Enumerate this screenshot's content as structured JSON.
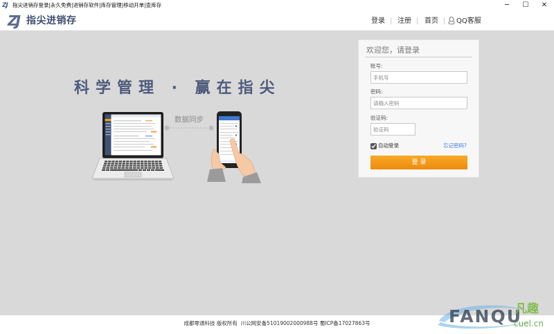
{
  "window": {
    "app_icon": "ZJ",
    "title": "指尖进销存登录|永久免费|进销存软件|库存管理|移动开单|查库存",
    "controls": {
      "minimize": {
        "icon": "minimize-icon",
        "glyph": "─"
      },
      "maximize": {
        "icon": "maximize-icon",
        "glyph": "☐"
      },
      "close": {
        "icon": "close-icon",
        "glyph": "✕"
      }
    }
  },
  "header": {
    "logo_mark": "ZJ",
    "logo_text": "指尖进销存",
    "separator": "|",
    "nav": [
      {
        "label": "登录"
      },
      {
        "label": "注册"
      },
      {
        "label": "首页"
      },
      {
        "label": "QQ客服",
        "icon": "qq-icon"
      }
    ]
  },
  "hero": {
    "slogan": "科学管理 · 赢在指尖",
    "sync_label": "数据同步"
  },
  "login": {
    "title": "欢迎您，请登录",
    "account_label": "账号:",
    "account_value": "",
    "account_placeholder": "手机号",
    "password_label": "密码:",
    "password_value": "",
    "password_placeholder": "请输入密码",
    "captcha_label": "验证码:",
    "captcha_value": "",
    "captcha_placeholder": "验证码",
    "auto_login_label": "自动登录",
    "auto_login_checked": true,
    "forgot_link": "忘记密码?",
    "submit_label": "登 录"
  },
  "footer": {
    "text": "成都零通科技 版权所有  川公网安备51019002000988号 蜀ICP备17027863号"
  },
  "watermark": {
    "brand": "FANQU",
    "brand_cn": "凡趣",
    "domain": "cuel.cn"
  },
  "colors": {
    "background": "#d9d9d9",
    "slogan": "#4d5b7c",
    "accent_orange": "#f0921a",
    "link_blue": "#3b7dd8",
    "panel": "#f7f7f7"
  }
}
